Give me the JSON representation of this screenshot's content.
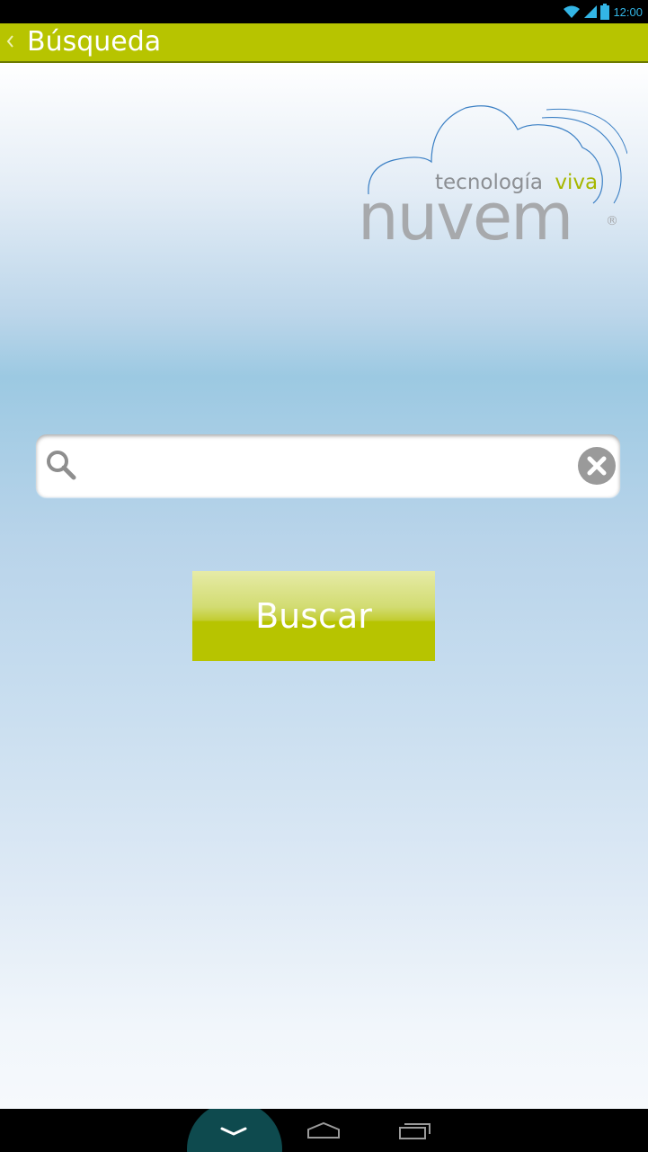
{
  "status_bar": {
    "time": "12:00",
    "icons": [
      "wifi-icon",
      "signal-icon",
      "battery-icon"
    ],
    "accent_color": "#33b5e5"
  },
  "action_bar": {
    "title": "Búsqueda",
    "background_color": "#b7c400",
    "back_icon": "chevron-left-icon"
  },
  "logo": {
    "tagline_gray": "tecnología",
    "tagline_green": "viva",
    "brand": "nuvem",
    "registered": "®",
    "cloud_color": "#3a7fc4",
    "brand_color": "#a7a9ac",
    "accent_color": "#a6b700"
  },
  "search": {
    "value": "",
    "placeholder": "",
    "search_icon": "search-icon",
    "clear_icon": "clear-icon"
  },
  "buscar_button": {
    "label": "Buscar",
    "color": "#b7c400"
  },
  "nav_bar": {
    "icons": [
      "hide-keyboard-icon",
      "home-icon",
      "recent-apps-icon"
    ]
  }
}
